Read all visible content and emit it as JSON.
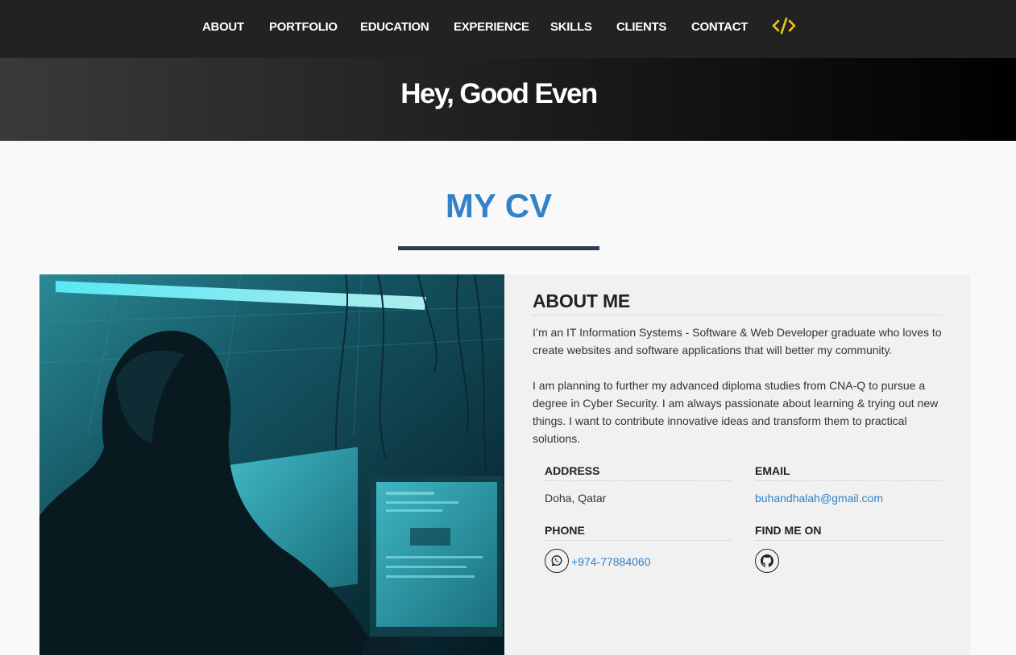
{
  "nav": {
    "items": [
      {
        "label": "ABOUT"
      },
      {
        "label": "PORTFOLIO"
      },
      {
        "label": "EDUCATION"
      },
      {
        "label": "EXPERIENCE"
      },
      {
        "label": "SKILLS"
      },
      {
        "label": "CLIENTS"
      },
      {
        "label": "CONTACT"
      }
    ],
    "code_icon": "code-icon",
    "code_icon_color": "#f5c518"
  },
  "hero": {
    "title": "Hey, Good Even"
  },
  "cv": {
    "title": "MY CV",
    "title_color": "#3182c8",
    "rule_color": "#2c3e50"
  },
  "about": {
    "heading": "ABOUT ME",
    "paragraph1": "I’m an IT Information Systems - Software & Web Developer graduate who loves to create websites and software applications that will better my community.",
    "paragraph2": "I am planning to further my advanced diploma studies from CNA-Q to pursue a degree in Cyber Security. I am always passionate about learning & trying out new things. I want to contribute innovative ideas and transform them to practical solutions.",
    "address_label": "ADDRESS",
    "address_value": "Doha, Qatar",
    "email_label": "EMAIL",
    "email_value": "buhandhalah@gmail.com",
    "phone_label": "PHONE",
    "phone_value": "+974-77884060",
    "phone_icon": "whatsapp-icon",
    "find_label": "FIND ME ON",
    "find_icon": "github-icon",
    "link_color": "#3182c8"
  }
}
